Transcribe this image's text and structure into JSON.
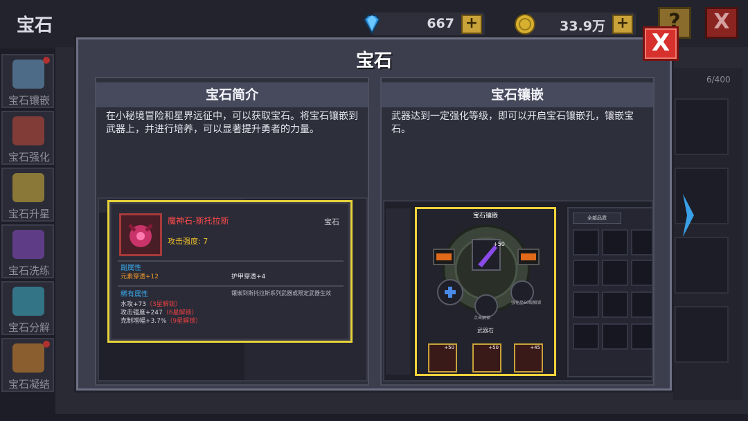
{
  "screen": {
    "title": "宝石"
  },
  "currency": {
    "gems": {
      "value": "667",
      "icon": "diamond-icon"
    },
    "coins": {
      "value": "33.9万",
      "icon": "coin-icon"
    },
    "plus": "+"
  },
  "top_buttons": {
    "help": "?",
    "exit": "X"
  },
  "sidebar": {
    "items": [
      {
        "label": "宝石镶嵌",
        "color": "#6aa0c8",
        "badge": true
      },
      {
        "label": "宝石强化",
        "color": "#c84a3a",
        "badge": false
      },
      {
        "label": "宝石升星",
        "color": "#d8b83a",
        "badge": false
      },
      {
        "label": "宝石洗练",
        "color": "#8a4ac8",
        "badge": false
      },
      {
        "label": "宝石分解",
        "color": "#3ab0c8",
        "badge": false
      },
      {
        "label": "宝石凝结",
        "color": "#d8882a",
        "badge": true
      }
    ]
  },
  "background": {
    "inventory_count": "6/400"
  },
  "dialog": {
    "title": "宝石",
    "close": "X",
    "intro": {
      "heading": "宝石简介",
      "text": "在小秘境冒险和星界远征中，可以获取宝石。将宝石镶嵌到武器上，并进行培养，可以显著提升勇者的力量。",
      "tooltip": {
        "name": "魔神石-斯托拉斯",
        "type": "宝石",
        "attack": "攻击强度: 7",
        "sub_heading": "副属性",
        "sub_left": "元素穿透+12",
        "sub_right": "护甲穿透+4",
        "rare_heading": "稀有属性",
        "rare_note": "镶嵌到斯托拉斯系列武器或限定武器生效",
        "rare_1": "水攻+73",
        "rare_1_lock": "（3星解锁）",
        "rare_2": "攻击强度+247",
        "rare_2_lock": "（6星解锁）",
        "rare_3": "克制增幅+3.7%",
        "rare_3_lock": "（9星解锁）"
      }
    },
    "inlay": {
      "heading": "宝石镶嵌",
      "text": "武器达到一定强化等级，即可以开启宝石镶嵌孔，镶嵌宝石。",
      "panel_title": "宝石镶嵌",
      "filter": "全部品质",
      "slot_bonus": "+50",
      "lock_1": "点击解锁",
      "lock_2": "强化至60级解锁",
      "weapon_label": "武器石",
      "small_slots": [
        "+50",
        "+50",
        "+45"
      ]
    }
  }
}
